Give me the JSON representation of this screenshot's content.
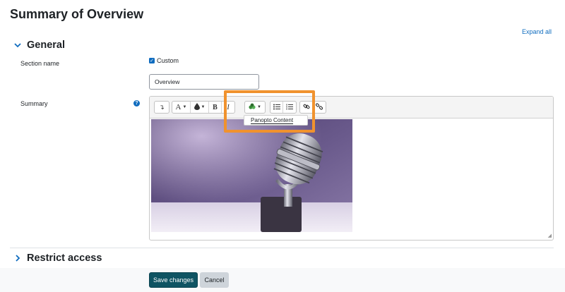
{
  "page": {
    "title": "Summary of Overview",
    "expand_all": "Expand all"
  },
  "general": {
    "heading": "General",
    "section_name_label": "Section name",
    "custom_label": "Custom",
    "custom_checked": true,
    "section_name_value": "Overview",
    "summary_label": "Summary"
  },
  "editor": {
    "toolbar": {
      "bold": "B",
      "italic": "I",
      "font": "A"
    },
    "dropdown_item": "Panopto Content"
  },
  "restrict": {
    "heading": "Restrict access"
  },
  "footer": {
    "save": "Save changes",
    "cancel": "Cancel"
  },
  "colors": {
    "accent": "#0f6cbf",
    "highlight": "#f0922e",
    "save_button": "#0f5463"
  }
}
